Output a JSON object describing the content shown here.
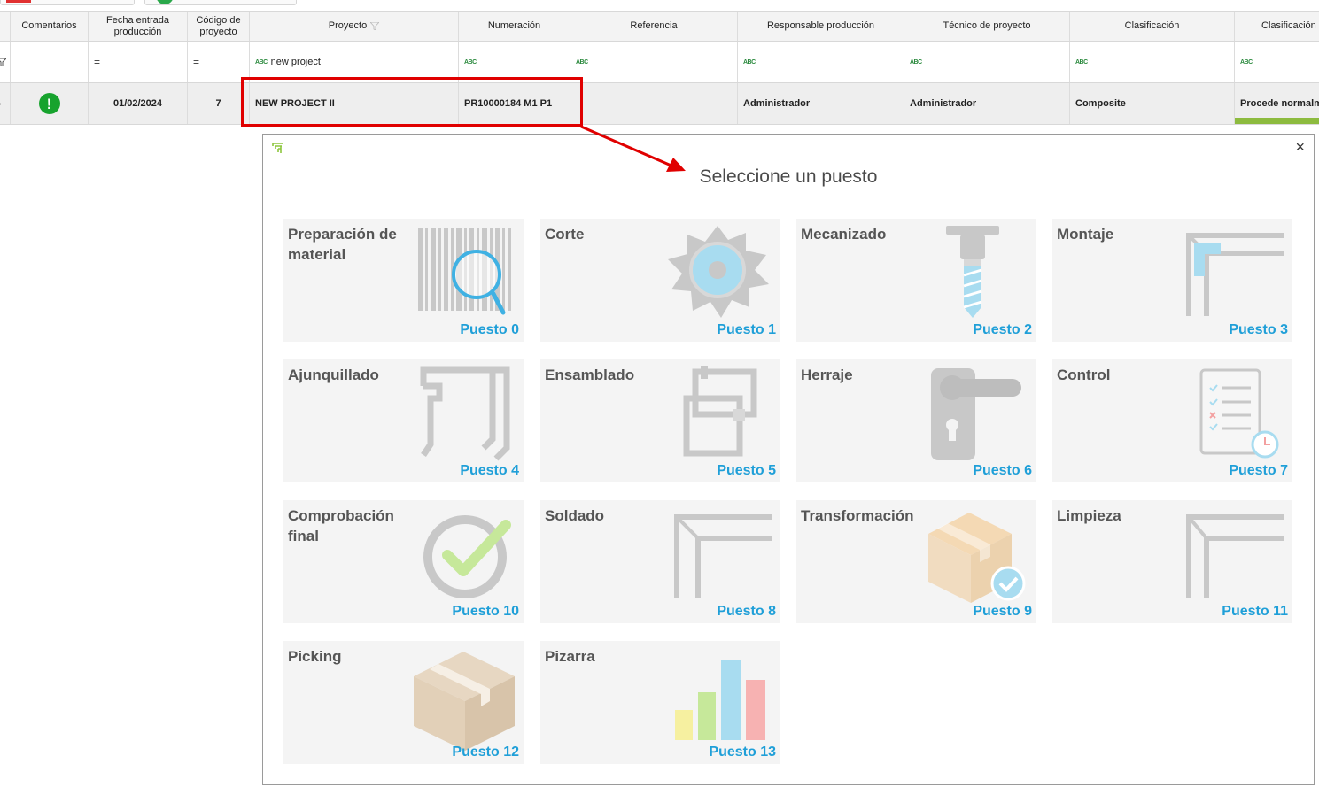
{
  "grid": {
    "columns": [
      "Comentarios",
      "Fecha entrada\nproducción",
      "Código de\nproyecto",
      "Proyecto",
      "Numeración",
      "Referencia",
      "Responsable producción",
      "Técnico de proyecto",
      "Clasificación",
      "Clasificación"
    ],
    "filter": {
      "fecha_op": "=",
      "codigo_op": "=",
      "proyecto_value": "new project",
      "abc": "ABC"
    },
    "row": {
      "fecha": "01/02/2024",
      "codigo": "7",
      "proyecto": "NEW PROJECT II",
      "numeracion": "PR10000184 M1 P1",
      "referencia": "",
      "responsable": "Administrador",
      "tecnico": "Administrador",
      "clasificacion": "Composite",
      "clasificacion2": "Procede normalm"
    }
  },
  "dialog": {
    "title": "Seleccione un puesto",
    "close": "×",
    "tiles": [
      {
        "name": "Preparación de material",
        "puesto": "Puesto 0",
        "icon": "barcode-magnifier-icon"
      },
      {
        "name": "Corte",
        "puesto": "Puesto 1",
        "icon": "saw-blade-icon"
      },
      {
        "name": "Mecanizado",
        "puesto": "Puesto 2",
        "icon": "drill-bit-icon"
      },
      {
        "name": "Montaje",
        "puesto": "Puesto 3",
        "icon": "frame-corner-icon"
      },
      {
        "name": "Ajunquillado",
        "puesto": "Puesto 4",
        "icon": "glazing-bead-icon"
      },
      {
        "name": "Ensamblado",
        "puesto": "Puesto 5",
        "icon": "assembly-frame-icon"
      },
      {
        "name": "Herraje",
        "puesto": "Puesto 6",
        "icon": "door-handle-icon"
      },
      {
        "name": "Control",
        "puesto": "Puesto 7",
        "icon": "checklist-icon"
      },
      {
        "name": "Comprobación final",
        "puesto": "Puesto 10",
        "icon": "check-circle-icon"
      },
      {
        "name": "Soldado",
        "puesto": "Puesto 8",
        "icon": "weld-corner-icon"
      },
      {
        "name": "Transformación",
        "puesto": "Puesto 9",
        "icon": "box-check-icon"
      },
      {
        "name": "Limpieza",
        "puesto": "Puesto 11",
        "icon": "clean-corner-icon"
      },
      {
        "name": "Picking",
        "puesto": "Puesto 12",
        "icon": "box-icon"
      },
      {
        "name": "Pizarra",
        "puesto": "Puesto 13",
        "icon": "bar-chart-icon"
      }
    ]
  },
  "colors": {
    "accent": "#1f9fd8",
    "annotation": "#e00000",
    "status_ok": "#17a32e",
    "classification_bar": "#8dbb3f"
  }
}
